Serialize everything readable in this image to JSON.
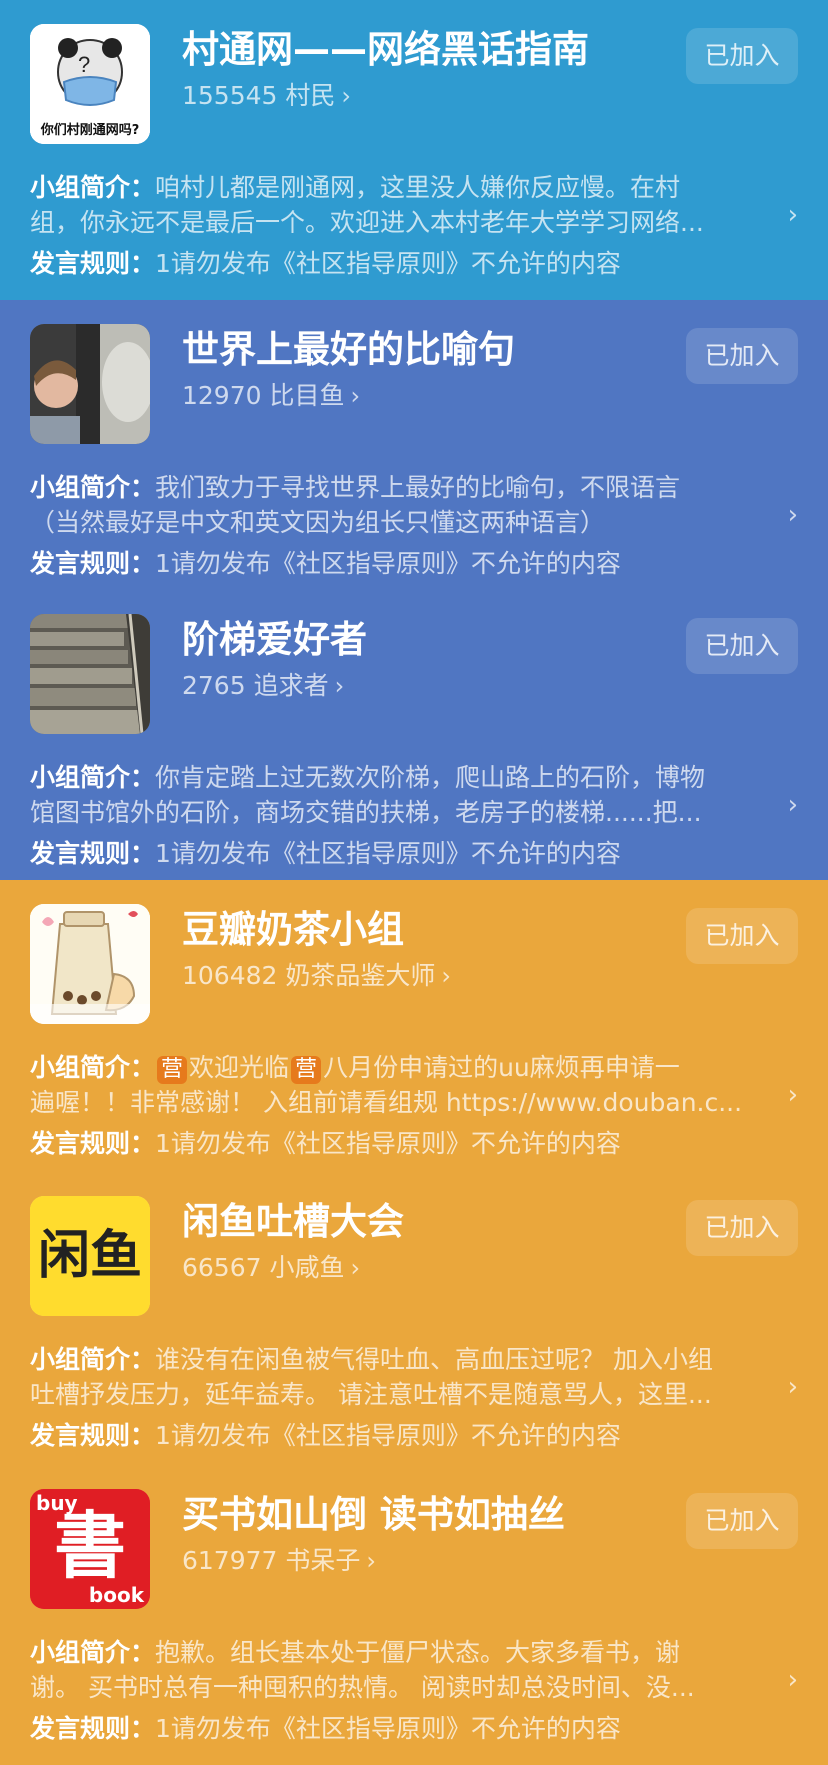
{
  "groups": [
    {
      "title": "村通网——网络黑话指南",
      "members": "155545 村民",
      "join_label": "已加入",
      "intro_label": "小组简介：",
      "intro_line1": "咱村儿都是刚通网，这里没人嫌你反应慢。在村",
      "intro_line2": "组，你永远不是最后一个。欢迎进入本村老年大学学习网络...",
      "rule_label": "发言规则：",
      "rule_text": "1请勿发布《社区指导原则》不允许的内容",
      "avatar_text": "你们村刚通网吗?",
      "bg": "#2f9bd0",
      "icon": "meme-face-icon"
    },
    {
      "title": "世界上最好的比喻句",
      "members": "12970 比目鱼",
      "join_label": "已加入",
      "intro_label": "小组简介：",
      "intro_line1": "我们致力于寻找世界上最好的比喻句，不限语言",
      "intro_line2": "（当然最好是中文和英文因为组长只懂这两种语言）",
      "rule_label": "发言规则：",
      "rule_text": "1请勿发布《社区指导原则》不允许的内容",
      "bg": "#5076c2",
      "icon": "movie-still-icon"
    },
    {
      "title": "阶梯爱好者",
      "members": "2765 追求者",
      "join_label": "已加入",
      "intro_label": "小组简介：",
      "intro_line1": "你肯定踏上过无数次阶梯，爬山路上的石阶，博物",
      "intro_line2": "馆图书馆外的石阶，商场交错的扶梯，老房子的楼梯......把...",
      "rule_label": "发言规则：",
      "rule_text": "1请勿发布《社区指导原则》不允许的内容",
      "bg": "#5076c2",
      "icon": "stairs-photo-icon"
    },
    {
      "title": "豆瓣奶茶小组",
      "members": "106482 奶茶品鉴大师",
      "join_label": "已加入",
      "intro_label": "小组简介：",
      "intro_tag": "营",
      "intro_line1_a": "欢迎光临",
      "intro_line1_b": "八月份申请过的uu麻烦再申请一",
      "intro_line2": "遍喔！！非常感谢！ 入组前请看组规 https://www.douban.c...",
      "rule_label": "发言规则：",
      "rule_text": "1请勿发布《社区指导原则》不允许的内容",
      "bg": "#eaa73c",
      "icon": "milk-tea-icon"
    },
    {
      "title": "闲鱼吐槽大会",
      "members": "66567 小咸鱼",
      "join_label": "已加入",
      "intro_label": "小组简介：",
      "intro_line1": "谁没有在闲鱼被气得吐血、高血压过呢？ 加入小组",
      "intro_line2": "吐槽抒发压力，延年益寿。 请注意吐槽不是随意骂人，这里...",
      "rule_label": "发言规则：",
      "rule_text": "1请勿发布《社区指导原则》不允许的内容",
      "avatar_text": "闲鱼",
      "bg": "#eaa73c",
      "icon": "xianyu-logo-icon"
    },
    {
      "title": "买书如山倒 读书如抽丝",
      "members": "617977 书呆子",
      "join_label": "已加入",
      "intro_label": "小组简介：",
      "intro_line1": "抱歉。组长基本处于僵尸状态。大家多看书，谢",
      "intro_line2": "谢。 买书时总有一种囤积的热情。 阅读时却总没时间、没...",
      "rule_label": "发言规则：",
      "rule_text": "1请勿发布《社区指导原则》不允许的内容",
      "avatar_text": "書",
      "avatar_top": "buy",
      "avatar_bottom": "book",
      "bg": "#eaa73c",
      "icon": "book-logo-icon"
    }
  ],
  "chevron": "›"
}
